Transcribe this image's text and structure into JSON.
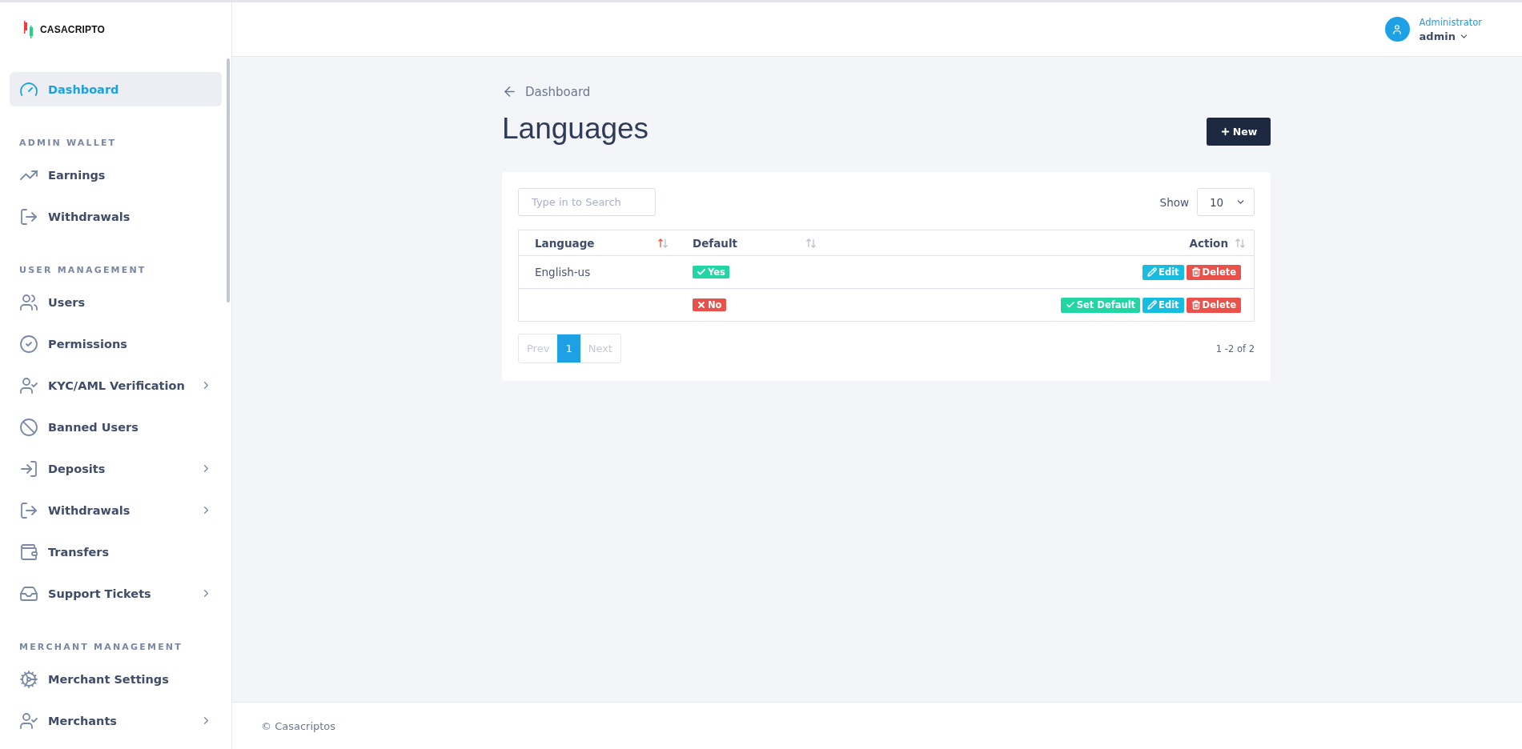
{
  "brand": "CASACRIPTO",
  "user": {
    "role": "Administrator",
    "name": "admin"
  },
  "sidebar": {
    "sections": [
      {
        "items": [
          {
            "label": "Dashboard",
            "selected": true,
            "has_submenu": false
          }
        ]
      },
      {
        "heading": "ADMIN WALLET",
        "items": [
          {
            "label": "Earnings",
            "selected": false,
            "has_submenu": false
          },
          {
            "label": "Withdrawals",
            "selected": false,
            "has_submenu": false
          }
        ]
      },
      {
        "heading": "USER MANAGEMENT",
        "items": [
          {
            "label": "Users",
            "selected": false,
            "has_submenu": false
          },
          {
            "label": "Permissions",
            "selected": false,
            "has_submenu": false
          },
          {
            "label": "KYC/AML Verification",
            "selected": false,
            "has_submenu": true
          },
          {
            "label": "Banned Users",
            "selected": false,
            "has_submenu": false
          },
          {
            "label": "Deposits",
            "selected": false,
            "has_submenu": true
          },
          {
            "label": "Withdrawals",
            "selected": false,
            "has_submenu": true
          },
          {
            "label": "Transfers",
            "selected": false,
            "has_submenu": false
          },
          {
            "label": "Support Tickets",
            "selected": false,
            "has_submenu": true
          }
        ]
      },
      {
        "heading": "MERCHANT MANAGEMENT",
        "items": [
          {
            "label": "Merchant Settings",
            "selected": false,
            "has_submenu": false
          },
          {
            "label": "Merchants",
            "selected": false,
            "has_submenu": true
          }
        ]
      }
    ]
  },
  "breadcrumb": "Dashboard",
  "title": "Languages",
  "new_button": "New",
  "search": {
    "placeholder": "Type in to Search"
  },
  "show": {
    "label": "Show",
    "value": "10"
  },
  "table": {
    "columns": [
      {
        "label": "Language",
        "sorted": true
      },
      {
        "label": "Default",
        "sorted": false
      },
      {
        "label": "Action",
        "sorted": false
      }
    ],
    "rows": [
      {
        "language": "English-us",
        "default": true,
        "default_label": "Yes",
        "actions": [
          {
            "kind": "edit",
            "label": "Edit"
          },
          {
            "kind": "delete",
            "label": "Delete"
          }
        ]
      },
      {
        "default": false,
        "default_label": "No",
        "actions": [
          {
            "kind": "set_default",
            "label": "Set Default"
          },
          {
            "kind": "edit",
            "label": "Edit"
          },
          {
            "kind": "delete",
            "label": "Delete"
          }
        ]
      }
    ]
  },
  "pagination": {
    "prev": "Prev",
    "pages": [
      {
        "label": "1",
        "selected": true
      }
    ],
    "next": "Next",
    "summary": "1 -2 of 2"
  },
  "footer": "© Casacriptos"
}
